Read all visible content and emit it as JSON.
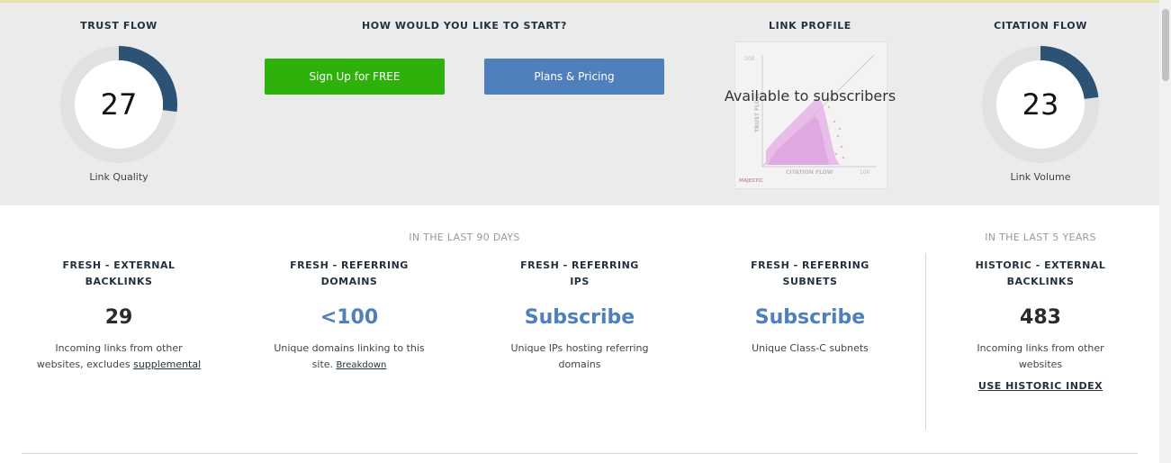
{
  "trust_flow": {
    "title": "TRUST FLOW",
    "value": "27",
    "caption": "Link Quality",
    "fraction": 0.27,
    "color": "#2c5274"
  },
  "start": {
    "title": "HOW WOULD YOU LIKE TO START?",
    "signup_label": "Sign Up for FREE",
    "pricing_label": "Plans & Pricing",
    "signup_color": "#2eb10a",
    "pricing_color": "#4f80bd"
  },
  "link_profile": {
    "title": "LINK PROFILE",
    "overlay": "Available to subscribers",
    "axis_y": "TRUST FLOW",
    "axis_x": "CITATION FLOW",
    "tick_max": "100",
    "brand": "MAJESTIC"
  },
  "citation_flow": {
    "title": "CITATION FLOW",
    "value": "23",
    "caption": "Link Volume",
    "fraction": 0.23,
    "color": "#2c5274"
  },
  "periods": {
    "last90": "IN THE LAST 90 DAYS",
    "last5y": "IN THE LAST 5 YEARS"
  },
  "stats": [
    {
      "title_l1": "FRESH - EXTERNAL",
      "title_l2": "BACKLINKS",
      "value": "29",
      "desc_l1": "Incoming links from other",
      "desc_l2": "websites, excludes ",
      "link": "supplemental"
    },
    {
      "title_l1": "FRESH - REFERRING",
      "title_l2": "DOMAINS",
      "value": "<100",
      "desc_l1": "Unique domains linking to this",
      "desc_l2": "site. ",
      "link": "Breakdown"
    },
    {
      "title_l1": "FRESH - REFERRING",
      "title_l2": "IPS",
      "value": "Subscribe",
      "desc_l1": "Unique IPs hosting referring",
      "desc_l2": "domains"
    },
    {
      "title_l1": "FRESH - REFERRING",
      "title_l2": "SUBNETS",
      "value": "Subscribe",
      "desc_l1": "Unique Class-C subnets"
    },
    {
      "title_l1": "HISTORIC - EXTERNAL",
      "title_l2": "BACKLINKS",
      "value": "483",
      "desc_l1": "Incoming links from other",
      "desc_l2": "websites",
      "link": "USE HISTORIC INDEX"
    }
  ]
}
